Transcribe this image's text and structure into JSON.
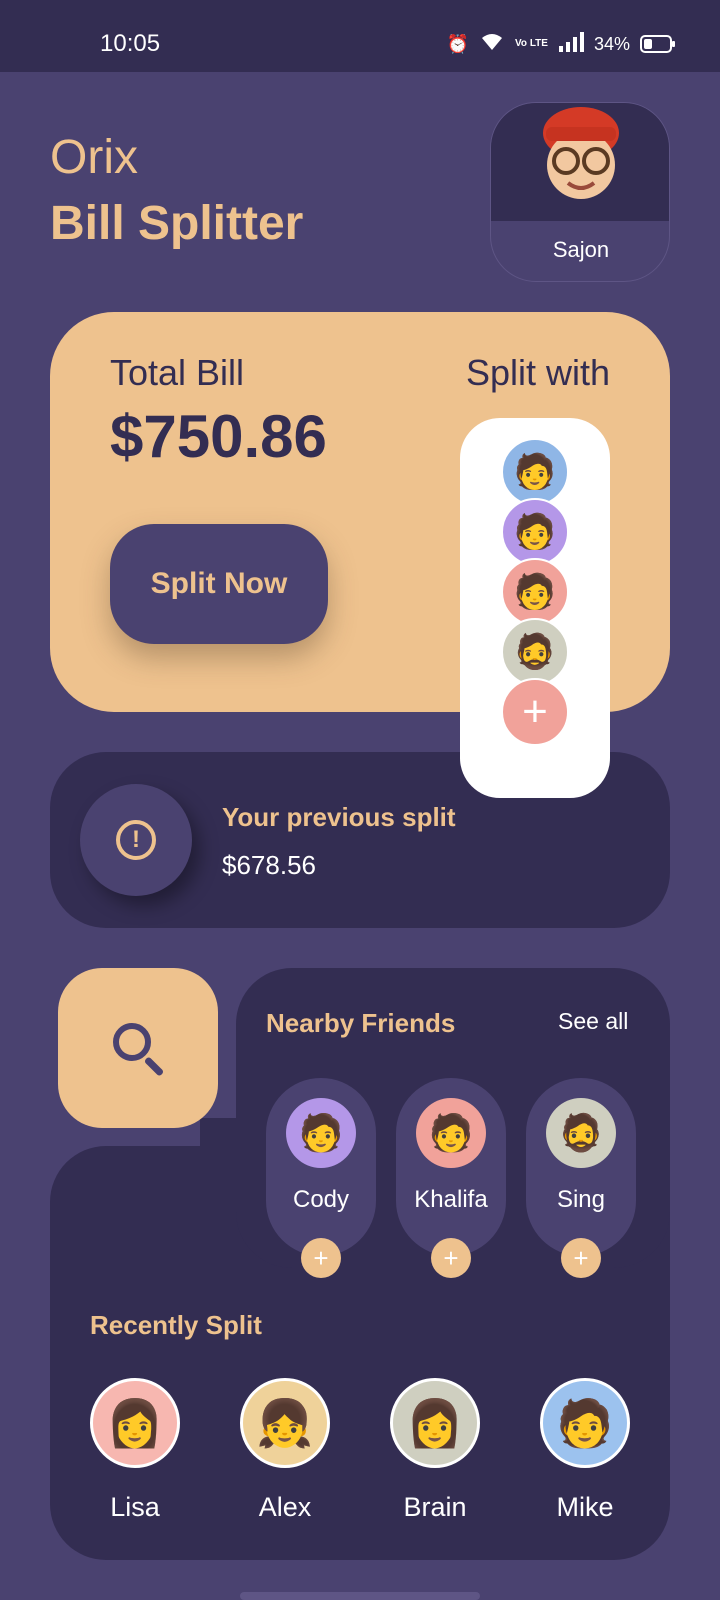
{
  "status": {
    "time": "10:05",
    "battery": "34%",
    "battery_level": 0.34,
    "volte": "Vo LTE"
  },
  "header": {
    "brand": "Orix",
    "title": "Bill Splitter"
  },
  "profile": {
    "name": "Sajon",
    "avatar": "memoji-red-beanie"
  },
  "bill": {
    "total_label": "Total Bill",
    "amount": "$750.86",
    "split_button": "Split Now",
    "split_with_label": "Split with"
  },
  "split_with": [
    {
      "avatar": "memoji-glasses",
      "color": "#8fb6e6"
    },
    {
      "avatar": "memoji-blue-hat",
      "color": "#b497e8"
    },
    {
      "avatar": "memoji-red-glasses",
      "color": "#f1a29a"
    },
    {
      "avatar": "memoji-turban",
      "color": "#cfcfc0"
    }
  ],
  "add_split_label": "+",
  "previous": {
    "title": "Your previous split",
    "amount": "$678.56",
    "icon": "info-icon"
  },
  "nearby": {
    "title": "Nearby Friends",
    "see_all": "See all",
    "add_label": "+",
    "friends": [
      {
        "name": "Cody",
        "color": "#b497e8",
        "avatar": "memoji-blue-hat"
      },
      {
        "name": "Khalifa",
        "color": "#f1a29a",
        "avatar": "memoji-red-glasses"
      },
      {
        "name": "Sing",
        "color": "#cfcfc0",
        "avatar": "memoji-turban"
      }
    ]
  },
  "recent": {
    "title": "Recently Split",
    "people": [
      {
        "name": "Lisa",
        "color": "#f7b7b0",
        "avatar": "memoji-hijab"
      },
      {
        "name": "Alex",
        "color": "#efd29a",
        "avatar": "memoji-beret"
      },
      {
        "name": "Brain",
        "color": "#cfcfc0",
        "avatar": "memoji-sunglasses"
      },
      {
        "name": "Mike",
        "color": "#9cc2ee",
        "avatar": "memoji-glasses"
      }
    ]
  },
  "colors": {
    "accent": "#eec28e",
    "background": "#4a4270",
    "panel": "#332d52"
  }
}
